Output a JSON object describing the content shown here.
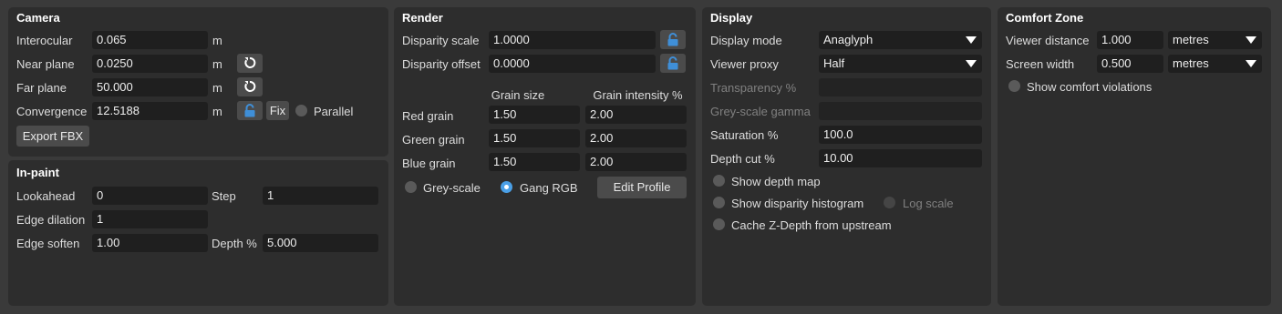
{
  "camera": {
    "title": "Camera",
    "interocular": {
      "label": "Interocular",
      "value": "0.065",
      "unit": "m"
    },
    "near_plane": {
      "label": "Near plane",
      "value": "0.0250",
      "unit": "m"
    },
    "far_plane": {
      "label": "Far plane",
      "value": "50.000",
      "unit": "m"
    },
    "convergence": {
      "label": "Convergence",
      "value": "12.5188",
      "unit": "m",
      "fix_label": "Fix",
      "parallel_label": "Parallel"
    },
    "export_label": "Export FBX"
  },
  "inpaint": {
    "title": "In-paint",
    "lookahead": {
      "label": "Lookahead",
      "value": "0"
    },
    "step": {
      "label": "Step",
      "value": "1"
    },
    "edge_dilation": {
      "label": "Edge dilation",
      "value": "1"
    },
    "edge_soften": {
      "label": "Edge soften",
      "value": "1.00"
    },
    "depth": {
      "label": "Depth %",
      "value": "5.000"
    }
  },
  "render": {
    "title": "Render",
    "disparity_scale": {
      "label": "Disparity scale",
      "value": "1.0000"
    },
    "disparity_offset": {
      "label": "Disparity offset",
      "value": "0.0000"
    },
    "col_grain_size": "Grain size",
    "col_grain_intensity": "Grain intensity %",
    "grains": [
      {
        "label": "Red grain",
        "size": "1.50",
        "intensity": "2.00"
      },
      {
        "label": "Green grain",
        "size": "1.50",
        "intensity": "2.00"
      },
      {
        "label": "Blue grain",
        "size": "1.50",
        "intensity": "2.00"
      }
    ],
    "greyscale_label": "Grey-scale",
    "gang_rgb_label": "Gang RGB",
    "edit_profile_label": "Edit Profile"
  },
  "display": {
    "title": "Display",
    "display_mode": {
      "label": "Display mode",
      "value": "Anaglyph"
    },
    "viewer_proxy": {
      "label": "Viewer proxy",
      "value": "Half"
    },
    "transparency": {
      "label": "Transparency %",
      "value": ""
    },
    "greyscale_gamma": {
      "label": "Grey-scale gamma",
      "value": ""
    },
    "saturation": {
      "label": "Saturation %",
      "value": "100.0"
    },
    "depth_cut": {
      "label": "Depth cut %",
      "value": "10.00"
    },
    "show_depth_map_label": "Show depth map",
    "show_histogram_label": "Show disparity histogram",
    "log_scale_label": "Log scale",
    "cache_zdepth_label": "Cache Z-Depth from upstream"
  },
  "comfort": {
    "title": "Comfort Zone",
    "viewer_distance": {
      "label": "Viewer distance",
      "value": "1.000",
      "unit": "metres"
    },
    "screen_width": {
      "label": "Screen width",
      "value": "0.500",
      "unit": "metres"
    },
    "show_violations_label": "Show comfort violations"
  },
  "colors": {
    "background": "#3a3a3a",
    "panel": "#2d2d2d",
    "field": "#1f1f1f",
    "accent": "#4a9fe6",
    "lock_icon": "#3f8fd8"
  }
}
